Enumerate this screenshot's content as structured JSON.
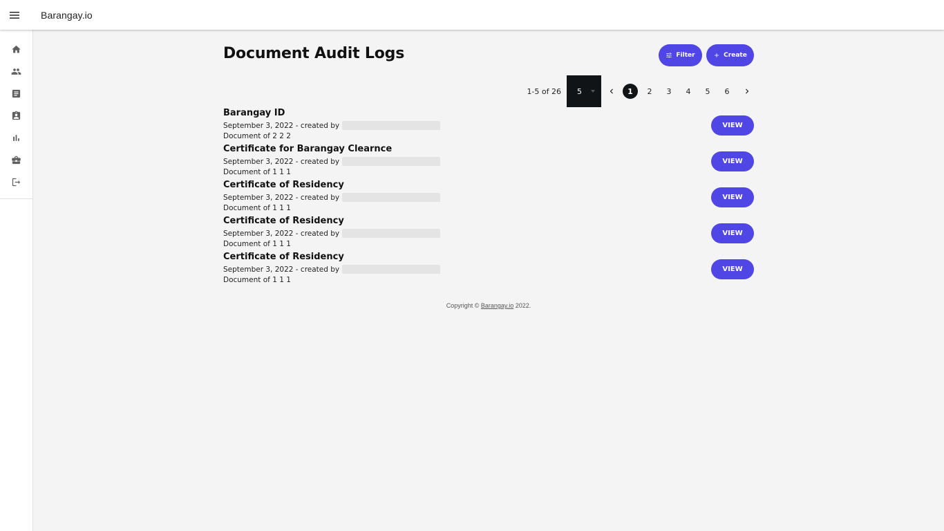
{
  "app": {
    "title": "Barangay.io"
  },
  "sidebar": {
    "items": [
      {
        "icon": "home-icon"
      },
      {
        "icon": "people-icon"
      },
      {
        "icon": "document-icon"
      },
      {
        "icon": "badge-icon"
      },
      {
        "icon": "bar-chart-icon"
      },
      {
        "icon": "briefcase-icon"
      },
      {
        "icon": "logout-icon"
      }
    ]
  },
  "page": {
    "title": "Document Audit Logs",
    "filter_label": "Filter",
    "create_label": "Create"
  },
  "pagination": {
    "range": "1-5 of 26",
    "rows_per_page": "5",
    "pages": [
      "1",
      "2",
      "3",
      "4",
      "5",
      "6"
    ],
    "current_page": "1"
  },
  "logs": [
    {
      "title": "Barangay ID",
      "meta": "September 3, 2022 - created by",
      "doc": "Document of 2 2 2",
      "action": "VIEW"
    },
    {
      "title": "Certificate for Barangay Clearnce",
      "meta": "September 3, 2022 - created by",
      "doc": "Document of 1 1 1",
      "action": "VIEW"
    },
    {
      "title": "Certificate of Residency",
      "meta": "September 3, 2022 - created by",
      "doc": "Document of 1 1 1",
      "action": "VIEW"
    },
    {
      "title": "Certificate of Residency",
      "meta": "September 3, 2022 - created by",
      "doc": "Document of 1 1 1",
      "action": "VIEW"
    },
    {
      "title": "Certificate of Residency",
      "meta": "September 3, 2022 - created by",
      "doc": "Document of 1 1 1",
      "action": "VIEW"
    }
  ],
  "footer": {
    "prefix": "Copyright © ",
    "link": "Barangay.io",
    "suffix": " 2022."
  },
  "colors": {
    "accent": "#4f46e5",
    "dark": "#111417",
    "background": "#f4f4f4"
  }
}
